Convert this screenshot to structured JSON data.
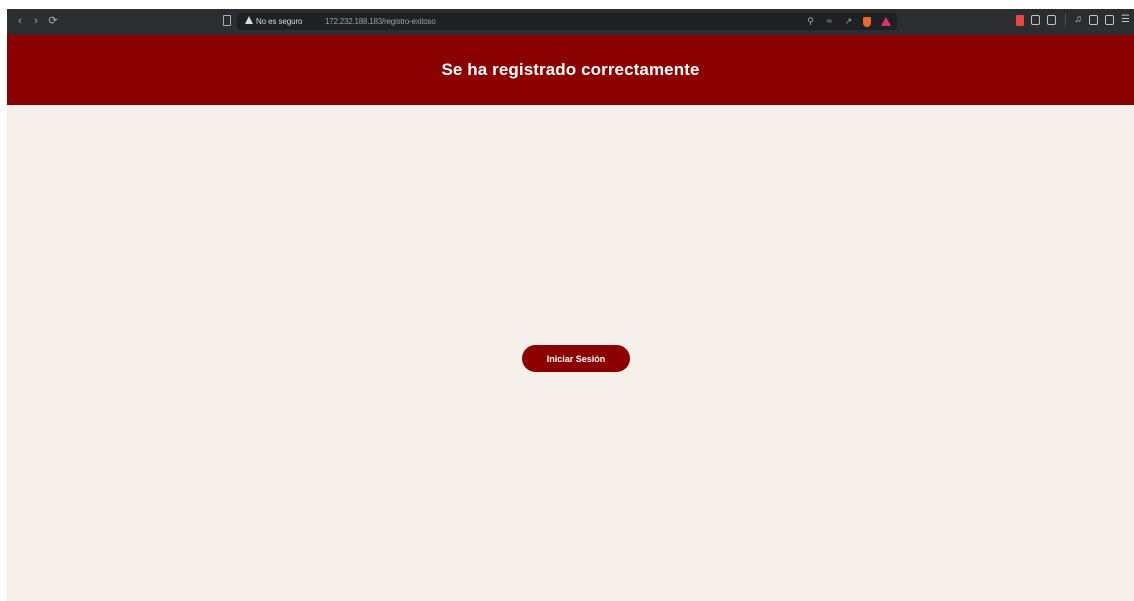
{
  "browser": {
    "security_label": "No es seguro",
    "url": "172.232.188.183/registro-exitoso"
  },
  "header": {
    "title": "Se ha registrado correctamente",
    "background": "#8b0000"
  },
  "main": {
    "login_button_label": "Iniciar Sesión",
    "background": "#f7f0ea"
  },
  "icons": [
    "back-icon",
    "forward-icon",
    "reload-icon",
    "bookmark-icon",
    "warning-icon",
    "zoom-icon",
    "translate-icon",
    "share-icon",
    "brave-shield-icon",
    "brave-rewards-icon"
  ]
}
